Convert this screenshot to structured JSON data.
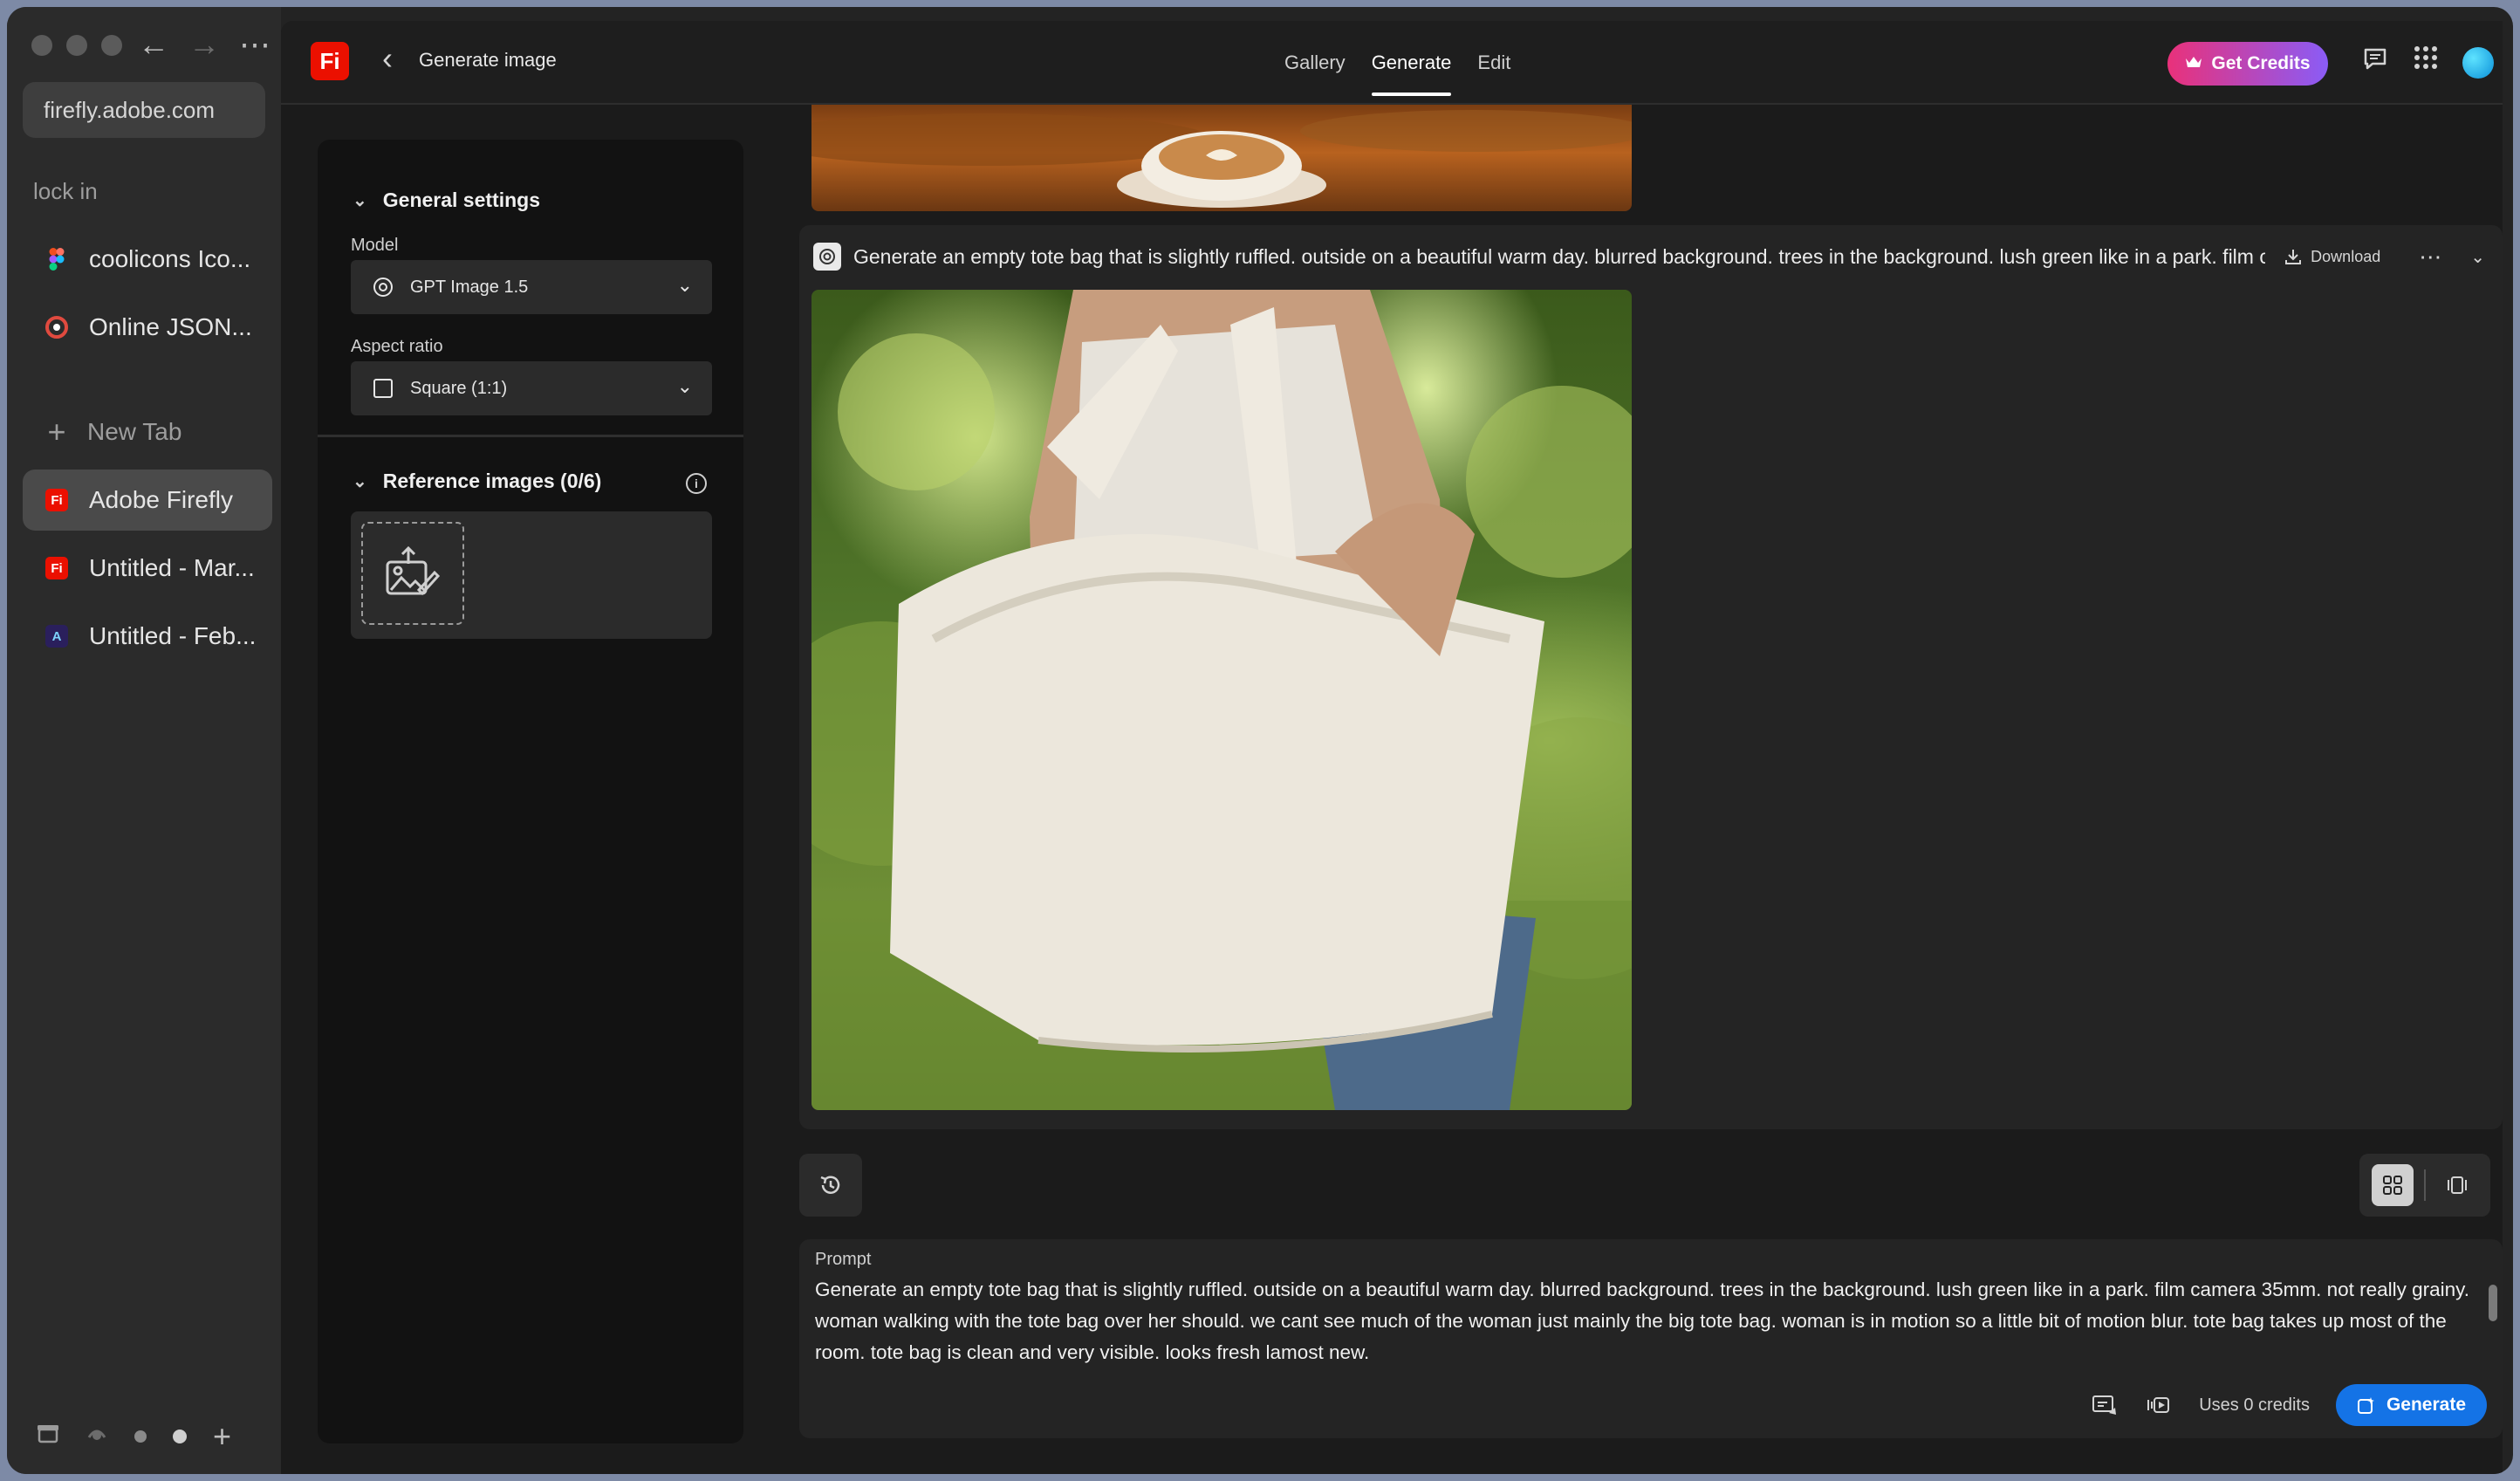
{
  "browser": {
    "url": "firefly.adobe.com",
    "space_label": "lock in",
    "pinned_tabs": [
      {
        "label": "coolicons Ico...",
        "favicon_color": "#a259ff"
      },
      {
        "label": "Online JSON...",
        "favicon_color": "#e04a3f"
      }
    ],
    "new_tab_label": "New Tab",
    "tabs": [
      {
        "label": "Adobe Firefly",
        "favicon": "Fi",
        "favicon_color": "#eb1000",
        "active": true
      },
      {
        "label": "Untitled - Mar...",
        "favicon": "Fi",
        "favicon_color": "#eb1000",
        "active": false
      },
      {
        "label": "Untitled - Feb...",
        "favicon": "A",
        "favicon_color": "#3a2a7a",
        "active": false
      }
    ]
  },
  "app": {
    "logo": "Fi",
    "title": "Generate image",
    "nav_tabs": [
      {
        "label": "Gallery",
        "active": false
      },
      {
        "label": "Generate",
        "active": true
      },
      {
        "label": "Edit",
        "active": false
      }
    ],
    "credits_button": "Get Credits",
    "accent_color": "#1473e6"
  },
  "settings": {
    "general_title": "General settings",
    "model_label": "Model",
    "model_value": "GPT Image 1.5",
    "aspect_label": "Aspect ratio",
    "aspect_value": "Square (1:1)",
    "reference_title": "Reference images (0/6)"
  },
  "generation": {
    "prompt_preview": "Generate an empty tote bag that is slightly ruffled. outside on a beautiful warm day. blurred background. trees in the background. lush green like in a park. film camer",
    "download_label": "Download"
  },
  "prompt": {
    "label": "Prompt",
    "text": "Generate an empty  tote bag that is slightly ruffled. outside on a beautiful warm day. blurred background. trees in the background. lush green like in a park. film camera 35mm. not really grainy. woman walking with the tote bag over her should. we cant see much of the woman just mainly the big tote bag. woman is in motion so a little bit of motion blur. tote bag takes up most of the room. tote bag is clean and very visible. looks fresh lamost new.",
    "uses_credits": "Uses 0 credits",
    "generate_label": "Generate"
  }
}
